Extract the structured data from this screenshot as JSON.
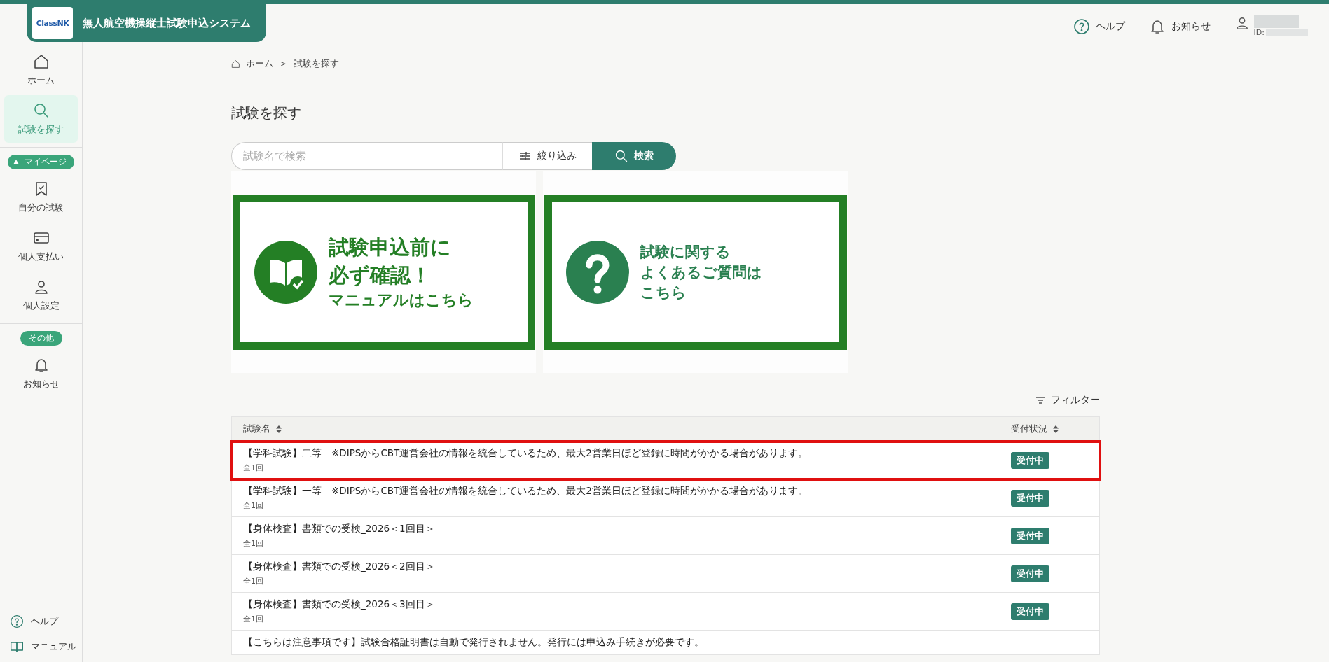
{
  "header": {
    "logo": "ClassNK",
    "title": "無人航空機操縦士試験申込システム",
    "links": [
      {
        "label": "ヘルプ"
      },
      {
        "label": "お知らせ"
      }
    ],
    "user": {
      "id_label": "ID:"
    }
  },
  "sidebar": {
    "sections": [
      {
        "items": [
          {
            "label": "ホーム",
            "selected": false
          },
          {
            "label": "試験を探す",
            "selected": true
          }
        ]
      },
      {
        "label": "マイページ",
        "expanded": true,
        "items": [
          {
            "label": "自分の試験",
            "selected": false
          },
          {
            "label": "個人支払い",
            "selected": false
          },
          {
            "label": "個人設定",
            "selected": false
          }
        ]
      },
      {
        "label": "その他",
        "items": [
          {
            "label": "お知らせ",
            "selected": false
          }
        ]
      }
    ],
    "footer_links": [
      {
        "label": "ヘルプ"
      },
      {
        "label": "マニュアル"
      }
    ]
  },
  "breadcrumb": [
    "ホーム",
    "＞",
    "試験を探す"
  ],
  "page_title": "試験を探す",
  "search": {
    "placeholder": "試験名で検索",
    "filter_button": "絞り込み",
    "search_button": "検索"
  },
  "banners": [
    {
      "lines": [
        "試験申込前に",
        "必ず確認！",
        "マニュアルはこちら"
      ]
    },
    {
      "lines": [
        "試験に関する",
        "よくあるご質問は",
        "こちら"
      ]
    }
  ],
  "filter_link": "フィルター",
  "table": {
    "columns": [
      "試験名",
      "受付状況"
    ],
    "rows": [
      {
        "name": "【学科試験】二等　※DIPSからCBT運営会社の情報を統合しているため、最大2営業日ほど登録に時間がかかる場合があります。",
        "sub": "全1回",
        "status": "受付中",
        "highlighted": true
      },
      {
        "name": "【学科試験】一等　※DIPSからCBT運営会社の情報を統合しているため、最大2営業日ほど登録に時間がかかる場合があります。",
        "sub": "全1回",
        "status": "受付中",
        "highlighted": false
      },
      {
        "name": "【身体検査】書類での受検_2026＜1回目＞",
        "sub": "全1回",
        "status": "受付中",
        "highlighted": false
      },
      {
        "name": "【身体検査】書類での受検_2026＜2回目＞",
        "sub": "全1回",
        "status": "受付中",
        "highlighted": false
      },
      {
        "name": "【身体検査】書類での受検_2026＜3回目＞",
        "sub": "全1回",
        "status": "受付中",
        "highlighted": false
      },
      {
        "name": "【こちらは注意事項です】試験合格証明書は自動で発行されません。発行には申込み手続きが必要です。",
        "highlighted": false
      }
    ]
  }
}
